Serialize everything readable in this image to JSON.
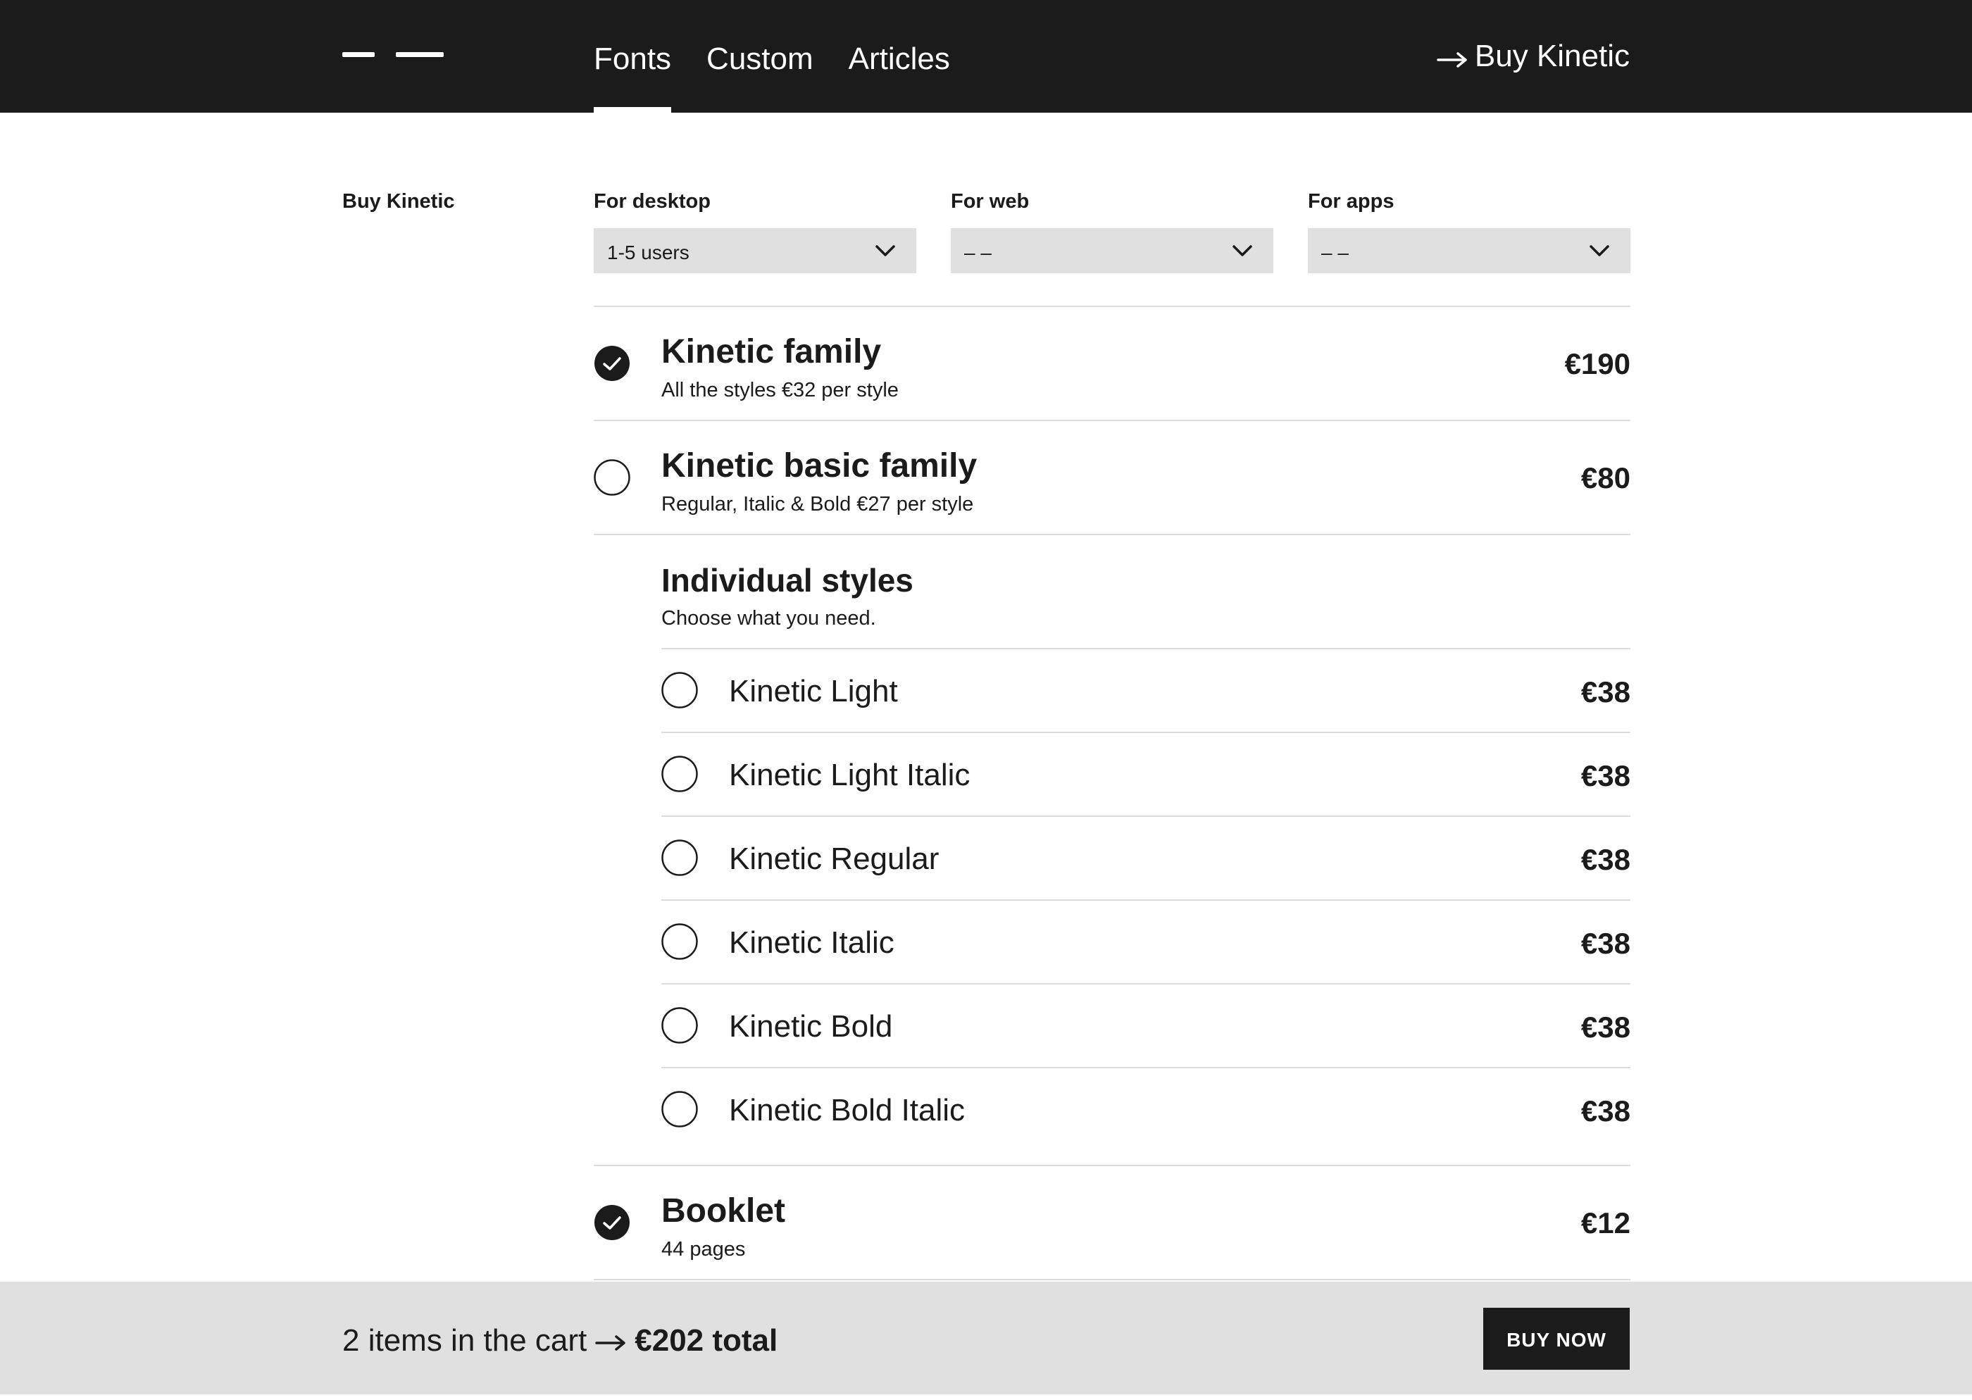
{
  "header": {
    "nav": [
      {
        "label": "Fonts",
        "active": true
      },
      {
        "label": "Custom",
        "active": false
      },
      {
        "label": "Articles",
        "active": false
      }
    ],
    "buy_link": "Buy Kinetic"
  },
  "side_label": "Buy Kinetic",
  "selectors": [
    {
      "label": "For desktop",
      "value": "1-5 users"
    },
    {
      "label": "For web",
      "value": "– –"
    },
    {
      "label": "For apps",
      "value": "– –"
    }
  ],
  "packages": [
    {
      "title": "Kinetic family",
      "subtitle": "All the styles €32 per style",
      "price": "€190",
      "selected": true
    },
    {
      "title": "Kinetic basic family",
      "subtitle": "Regular, Italic & Bold €27 per style",
      "price": "€80",
      "selected": false
    }
  ],
  "individual": {
    "title": "Individual styles",
    "subtitle": "Choose what you need.",
    "styles": [
      {
        "name": "Kinetic Light",
        "price": "€38",
        "selected": false
      },
      {
        "name": "Kinetic Light Italic",
        "price": "€38",
        "selected": false
      },
      {
        "name": "Kinetic Regular",
        "price": "€38",
        "selected": false
      },
      {
        "name": "Kinetic Italic",
        "price": "€38",
        "selected": false
      },
      {
        "name": "Kinetic Bold",
        "price": "€38",
        "selected": false
      },
      {
        "name": "Kinetic Bold Italic",
        "price": "€38",
        "selected": false
      }
    ]
  },
  "booklet": {
    "title": "Booklet",
    "subtitle": "44 pages",
    "price": "€12",
    "selected": true
  },
  "cart": {
    "count_text": "2 items in the cart",
    "total": "€202 total",
    "buy_label": "BUY NOW"
  },
  "colors": {
    "dark": "#1b1b1b",
    "light_gray": "#e0e0e0",
    "divider": "#dcdcdc",
    "white": "#ffffff"
  }
}
